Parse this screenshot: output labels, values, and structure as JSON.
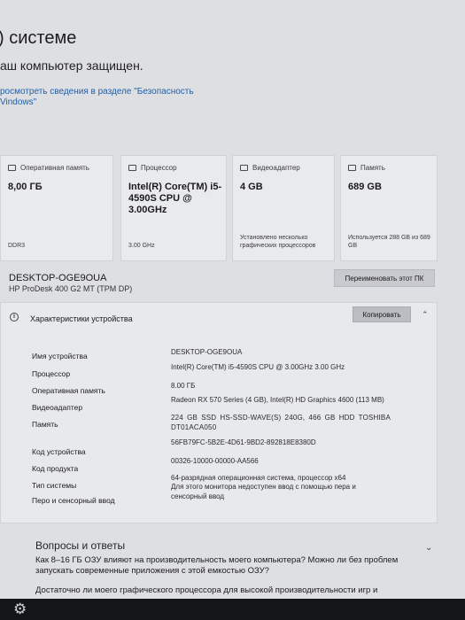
{
  "header": {
    "title": ") системе",
    "protected_text": "аш компьютер защищен.",
    "security_link": "росмотреть сведения в разделе \"Безопасность Vindows\""
  },
  "cards": [
    {
      "title": "Оперативная память",
      "value": "8,00 ГБ",
      "footer": "DDR3",
      "icon": "memory-icon"
    },
    {
      "title": "Процессор",
      "value": "Intel(R) Core(TM) i5-4590S CPU @ 3.00GHz",
      "footer": "3.00 GHz",
      "icon": "processor-icon"
    },
    {
      "title": "Видеоадаптер",
      "value": "4 GB",
      "footer": "Установлено несколько графических процессоров",
      "icon": "display-adapter-icon"
    },
    {
      "title": "Память",
      "value": "689 GB",
      "footer": "Используется 288 GB из 689 GB",
      "icon": "storage-icon"
    }
  ],
  "device": {
    "name": "DESKTOP-OGE9OUA",
    "model": "HP ProDesk 400 G2 MT (TPM DP)",
    "rename_label": "Переименовать этот ПК"
  },
  "specs": {
    "title": "Характеристики устройства",
    "copy_label": "Копировать",
    "rows": [
      {
        "label": "Имя устройства",
        "value": "DESKTOP-OGE9OUA"
      },
      {
        "label": "Процессор",
        "value": "Intel(R) Core(TM) i5-4590S CPU @ 3.00GHz   3.00 GHz"
      },
      {
        "label": "Оперативная память",
        "value": "8.00 ГБ"
      },
      {
        "label": "Видеоадаптер",
        "value": "Radeon RX 570 Series (4 GB), Intel(R) HD Graphics 4600 (113 MB)"
      },
      {
        "label": "Память",
        "value": "224 GB SSD HS-SSD-WAVE(S) 240G, 466 GB HDD TOSHIBA DT01ACA050"
      },
      {
        "label": "Код устройства",
        "value": "56FB79FC-5B2E-4D61-9BD2-892818E8380D"
      },
      {
        "label": "Код продукта",
        "value": "00326-10000-00000-AA566"
      },
      {
        "label": "Тип системы",
        "value": "64-разрядная операционная система, процессор x64"
      },
      {
        "label": "Перо и сенсорный ввод",
        "value": "Для этого монитора недоступен ввод с помощью пера и сенсорный ввод"
      }
    ]
  },
  "faq": {
    "title": "Вопросы и ответы",
    "items": [
      "Как 8–16 ГБ ОЗУ влияют на производительность моего компьютера? Можно ли без проблем запускать современные приложения с этой емкостью ОЗУ?",
      "Достаточно ли моего графического процессора для высокой производительности игр и"
    ]
  },
  "taskbar": {
    "icon": "gear-icon"
  }
}
